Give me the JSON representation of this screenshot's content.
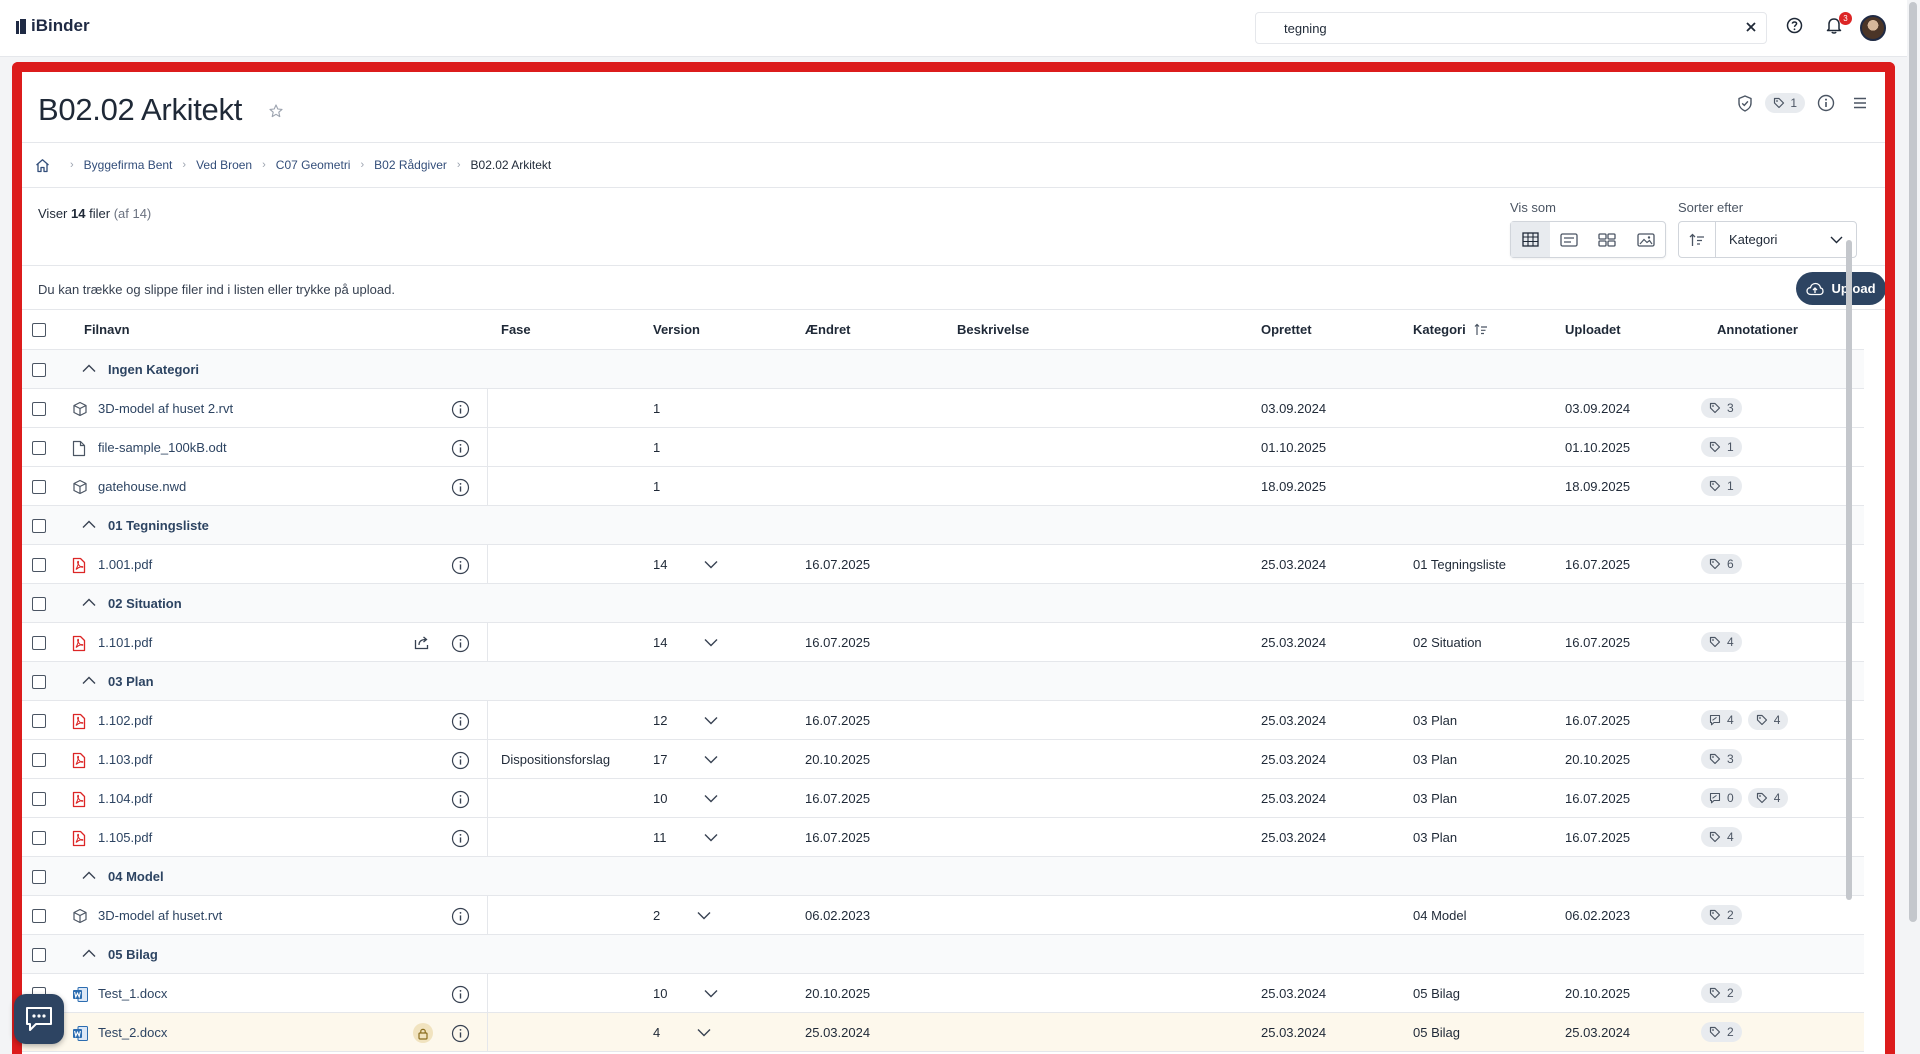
{
  "app": {
    "brand": "iBinder"
  },
  "search": {
    "value": "tegning"
  },
  "notifications": {
    "count": "3"
  },
  "page": {
    "title": "B02.02 Arkitekt",
    "tag_count": "1"
  },
  "breadcrumb": [
    {
      "label": "Byggefirma Bent"
    },
    {
      "label": "Ved Broen"
    },
    {
      "label": "C07 Geometri"
    },
    {
      "label": "B02 Rådgiver"
    },
    {
      "label": "B02.02 Arkitekt"
    }
  ],
  "summary": {
    "prefix": "Viser",
    "shown": "14",
    "unit": "filer",
    "total": "(af 14)"
  },
  "view": {
    "label": "Vis som"
  },
  "sort": {
    "label": "Sorter efter",
    "value": "Kategori"
  },
  "dropzone": {
    "text": "Du kan trække og slippe filer ind i listen eller trykke på upload."
  },
  "upload": {
    "label": "Upload"
  },
  "columns": {
    "filnavn": "Filnavn",
    "fase": "Fase",
    "version": "Version",
    "aendret": "Ændret",
    "beskrivelse": "Beskrivelse",
    "oprettet": "Oprettet",
    "kategori": "Kategori",
    "uploadet": "Uploadet",
    "annotationer": "Annotationer"
  },
  "groups": [
    {
      "name": "Ingen Kategori",
      "files": [
        {
          "icon": "model-icon",
          "name": "3D-model af huset 2.rvt",
          "fase": "",
          "version": "1",
          "has_history": false,
          "aendret": "",
          "oprettet": "03.09.2024",
          "kategori": "",
          "uploadet": "03.09.2024",
          "comments": null,
          "tags": "3"
        },
        {
          "icon": "document-icon",
          "name": "file-sample_100kB.odt",
          "fase": "",
          "version": "1",
          "has_history": false,
          "aendret": "",
          "oprettet": "01.10.2025",
          "kategori": "",
          "uploadet": "01.10.2025",
          "comments": null,
          "tags": "1"
        },
        {
          "icon": "model-icon",
          "name": "gatehouse.nwd",
          "fase": "",
          "version": "1",
          "has_history": false,
          "aendret": "",
          "oprettet": "18.09.2025",
          "kategori": "",
          "uploadet": "18.09.2025",
          "comments": null,
          "tags": "1"
        }
      ]
    },
    {
      "name": "01 Tegningsliste",
      "files": [
        {
          "icon": "pdf-icon",
          "name": "1.001.pdf",
          "fase": "",
          "version": "14",
          "has_history": true,
          "aendret": "16.07.2025",
          "oprettet": "25.03.2024",
          "kategori": "01 Tegningsliste",
          "uploadet": "16.07.2025",
          "comments": null,
          "tags": "6"
        }
      ]
    },
    {
      "name": "02 Situation",
      "files": [
        {
          "icon": "pdf-icon",
          "name": "1.101.pdf",
          "shared": true,
          "fase": "",
          "version": "14",
          "has_history": true,
          "aendret": "16.07.2025",
          "oprettet": "25.03.2024",
          "kategori": "02 Situation",
          "uploadet": "16.07.2025",
          "comments": null,
          "tags": "4"
        }
      ]
    },
    {
      "name": "03 Plan",
      "files": [
        {
          "icon": "pdf-icon",
          "name": "1.102.pdf",
          "fase": "",
          "version": "12",
          "has_history": true,
          "aendret": "16.07.2025",
          "oprettet": "25.03.2024",
          "kategori": "03 Plan",
          "uploadet": "16.07.2025",
          "comments": "4",
          "tags": "4"
        },
        {
          "icon": "pdf-icon",
          "name": "1.103.pdf",
          "fase": "Dispositionsforslag",
          "version": "17",
          "has_history": true,
          "aendret": "20.10.2025",
          "oprettet": "25.03.2024",
          "kategori": "03 Plan",
          "uploadet": "20.10.2025",
          "comments": null,
          "tags": "3"
        },
        {
          "icon": "pdf-icon",
          "name": "1.104.pdf",
          "fase": "",
          "version": "10",
          "has_history": true,
          "aendret": "16.07.2025",
          "oprettet": "25.03.2024",
          "kategori": "03 Plan",
          "uploadet": "16.07.2025",
          "comments": "0",
          "tags": "4"
        },
        {
          "icon": "pdf-icon",
          "name": "1.105.pdf",
          "fase": "",
          "version": "11",
          "has_history": true,
          "aendret": "16.07.2025",
          "oprettet": "25.03.2024",
          "kategori": "03 Plan",
          "uploadet": "16.07.2025",
          "comments": null,
          "tags": "4"
        }
      ]
    },
    {
      "name": "04 Model",
      "files": [
        {
          "icon": "model-icon",
          "name": "3D-model af huset.rvt",
          "fase": "",
          "version": "2",
          "has_history": true,
          "aendret": "06.02.2023",
          "oprettet": "",
          "kategori": "04 Model",
          "uploadet": "06.02.2023",
          "comments": null,
          "tags": "2"
        }
      ]
    },
    {
      "name": "05 Bilag",
      "files": [
        {
          "icon": "word-icon",
          "name": "Test_1.docx",
          "fase": "",
          "version": "10",
          "has_history": true,
          "aendret": "20.10.2025",
          "oprettet": "25.03.2024",
          "kategori": "05 Bilag",
          "uploadet": "20.10.2025",
          "comments": null,
          "tags": "2"
        },
        {
          "icon": "word-icon",
          "name": "Test_2.docx",
          "locked": true,
          "fase": "",
          "version": "4",
          "has_history": true,
          "aendret": "25.03.2024",
          "oprettet": "25.03.2024",
          "kategori": "05 Bilag",
          "uploadet": "25.03.2024",
          "comments": null,
          "tags": "2"
        }
      ]
    }
  ],
  "colors": {
    "frame": "#dc1c1c",
    "primary": "#2d4462",
    "pdf": "#dc2626",
    "word": "#2b6cb0"
  }
}
